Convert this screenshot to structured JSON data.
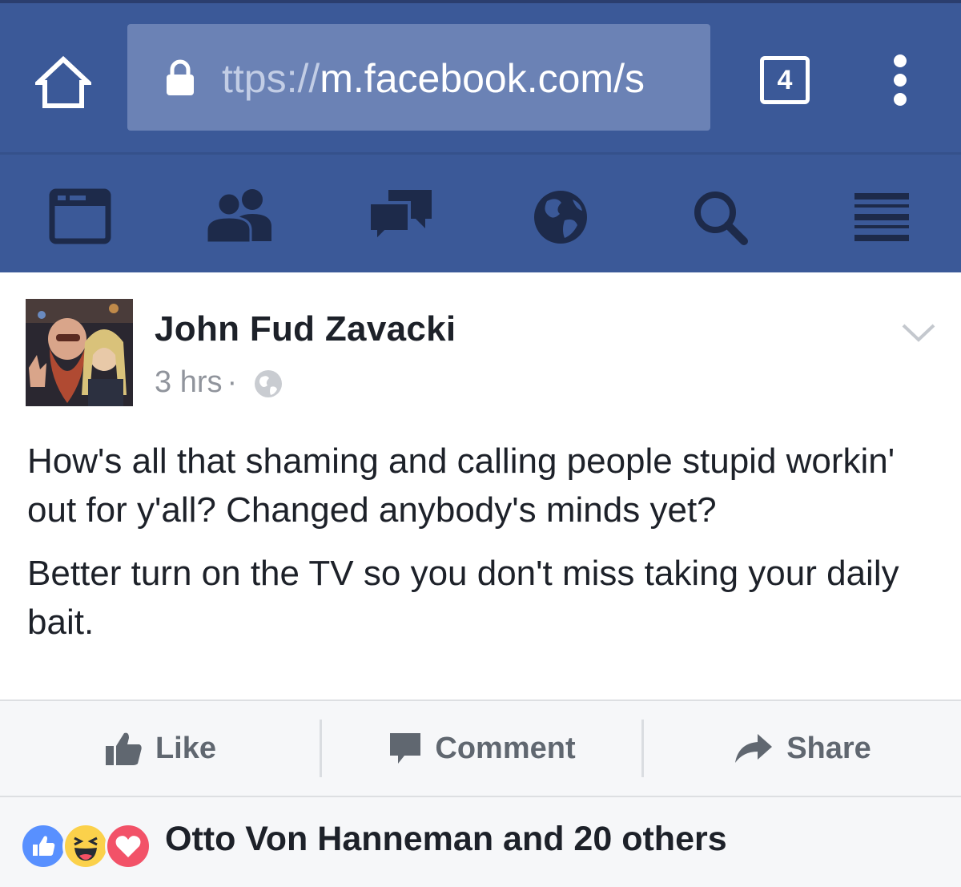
{
  "browser": {
    "url_prefix": "ttps://",
    "url_main": "m.facebook.com/s",
    "tab_count": "4",
    "icons": [
      "home-icon",
      "lock-icon",
      "tabs-icon",
      "overflow-menu-icon"
    ]
  },
  "fb_nav": {
    "items": [
      "news-feed-icon",
      "friend-requests-icon",
      "messages-icon",
      "notifications-globe-icon",
      "search-icon",
      "menu-icon"
    ]
  },
  "post": {
    "author": "John Fud Zavacki",
    "time": "3 hrs",
    "separator": "·",
    "privacy_icon": "globe-icon",
    "paragraphs": [
      "How's all that shaming and calling people stupid workin' out for y'all? Changed anybody's minds yet?",
      "Better turn on the TV so you don't miss taking your daily bait."
    ]
  },
  "actions": {
    "like": "Like",
    "comment": "Comment",
    "share": "Share"
  },
  "reactions": {
    "icons": [
      "like-reaction-icon",
      "haha-reaction-icon",
      "love-reaction-icon"
    ],
    "summary": "Otto Von Hanneman and 20 others"
  },
  "colors": {
    "brand_blue": "#3b5998",
    "url_box": "#6b82b5",
    "nav_icon": "#1d2a4a",
    "action_gray": "#606770",
    "like_blue": "#5890ff",
    "love_red": "#f25268",
    "haha_yellow": "#fbd14b"
  }
}
